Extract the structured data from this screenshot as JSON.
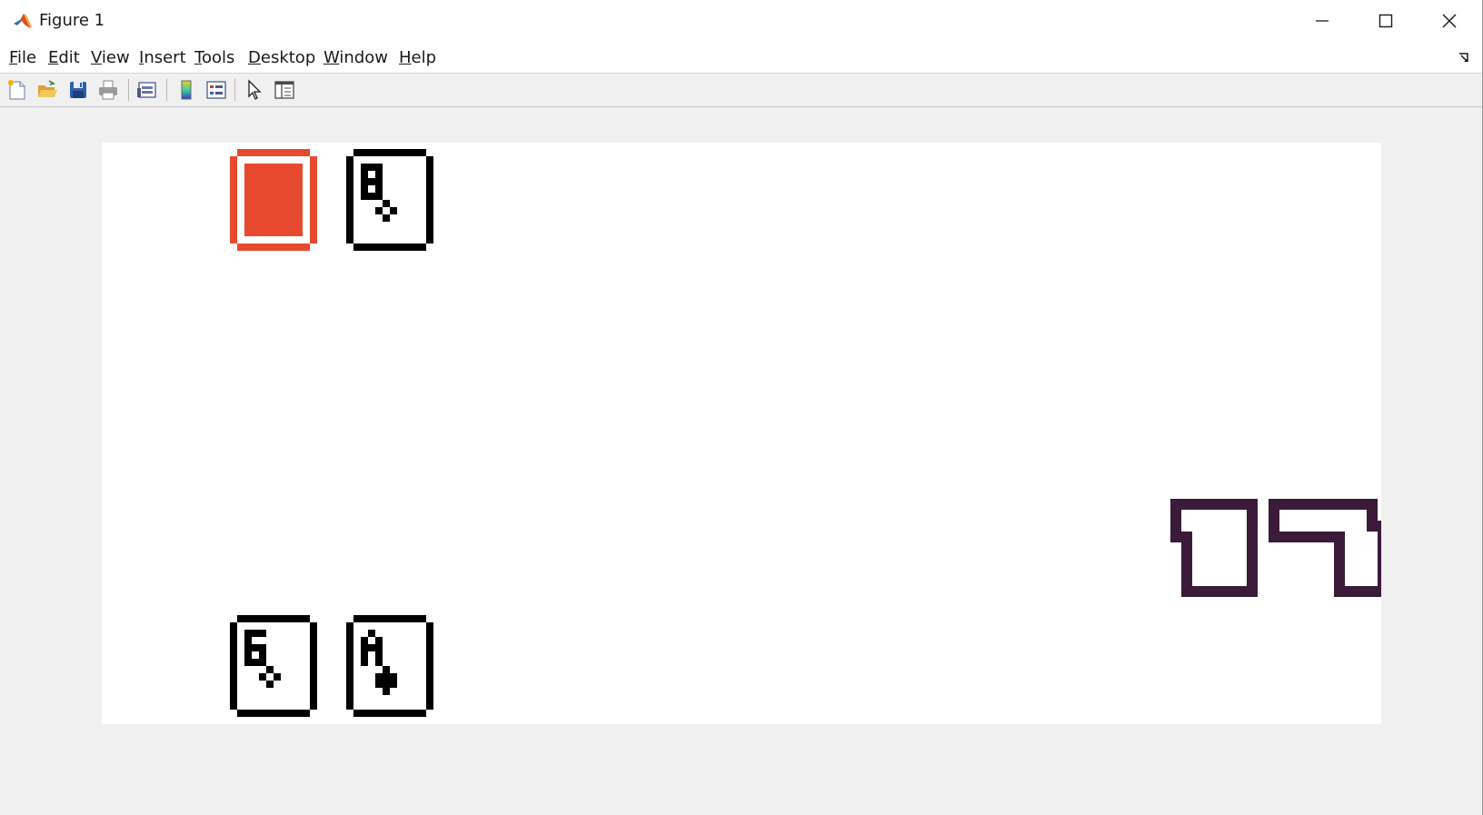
{
  "window": {
    "title": "Figure 1"
  },
  "menubar": {
    "items": [
      {
        "key": "F",
        "rest": "ile",
        "name": "menu-file"
      },
      {
        "key": "E",
        "rest": "dit",
        "name": "menu-edit"
      },
      {
        "key": "V",
        "rest": "iew",
        "name": "menu-view"
      },
      {
        "key": "I",
        "rest": "nsert",
        "name": "menu-insert"
      },
      {
        "key": "T",
        "rest": "ools",
        "name": "menu-tools"
      },
      {
        "key": "D",
        "rest": "esktop",
        "name": "menu-desktop"
      },
      {
        "key": "W",
        "rest": "indow",
        "name": "menu-window"
      },
      {
        "key": "H",
        "rest": "elp",
        "name": "menu-help"
      }
    ]
  },
  "toolbar": {
    "icons": [
      "new-figure-icon",
      "open-file-icon",
      "save-icon",
      "print-icon",
      "print-preview-icon",
      "colorbar-icon",
      "legend-icon",
      "edit-plot-arrow-icon",
      "property-inspector-icon"
    ]
  },
  "game": {
    "dealer_hand": [
      {
        "face_down": true,
        "back_color": "#e84a2f"
      },
      {
        "rank": "8",
        "suit": "clubs"
      }
    ],
    "player_hand": [
      {
        "rank": "6",
        "suit": "clubs"
      },
      {
        "rank": "A",
        "suit": "spades"
      }
    ],
    "player_total": "17",
    "score_color": "#3b1a3a"
  }
}
